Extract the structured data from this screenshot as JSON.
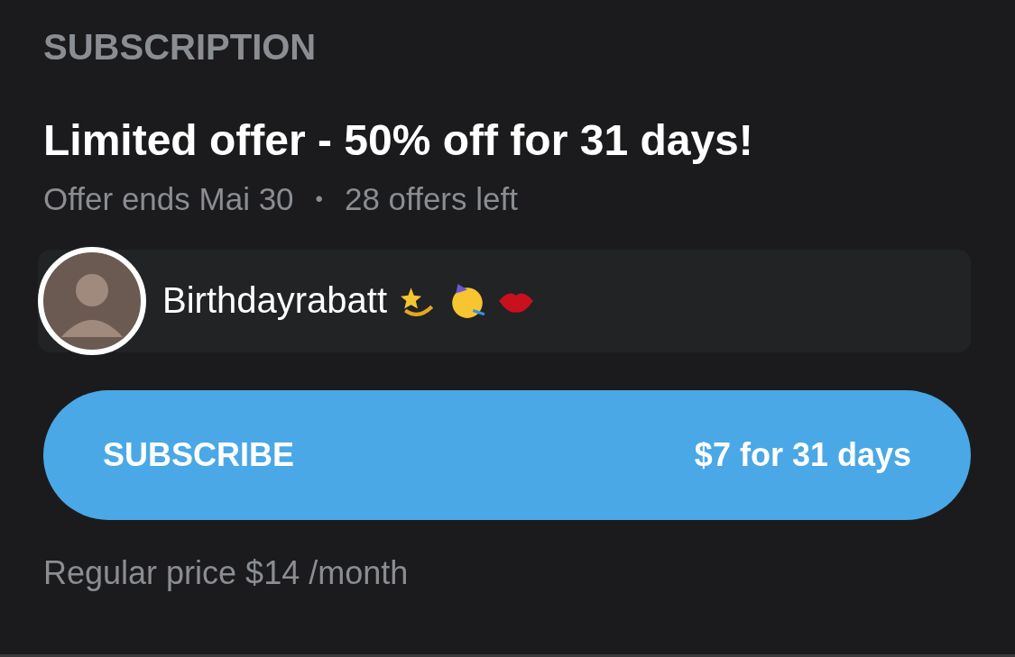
{
  "section_title": "SUBSCRIPTION",
  "offer": {
    "title": "Limited offer - 50% off for 31 days!",
    "ends": "Offer ends Mai 30",
    "separator": "•",
    "remaining": "28 offers left"
  },
  "promo": {
    "message": "Birthdayrabatt"
  },
  "subscribe_button": {
    "label": "SUBSCRIBE",
    "price": "$7 for 31 days"
  },
  "regular_price": "Regular price $14 /month"
}
